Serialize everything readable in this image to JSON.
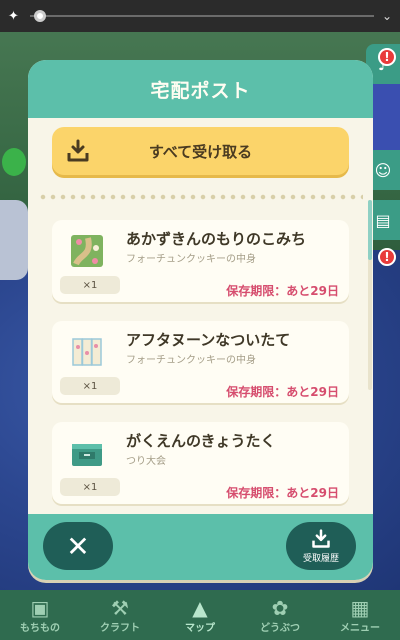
{
  "topbar": {
    "mode_icon": "sparkle-icon",
    "chevron": "⌄"
  },
  "side_badges": [
    "!",
    "!"
  ],
  "modal": {
    "title": "宅配ポスト",
    "receive_all_label": "すべて受け取る",
    "items": [
      {
        "name": "あかずきんのもりのこみち",
        "source": "フォーチュンクッキーの中身",
        "quantity": "×1",
        "expiry": "保存期限：あと29日",
        "icon": "forest-path-icon"
      },
      {
        "name": "アフタヌーンなついたて",
        "source": "フォーチュンクッキーの中身",
        "quantity": "×1",
        "expiry": "保存期限：あと29日",
        "icon": "folding-screen-icon"
      },
      {
        "name": "がくえんのきょうたく",
        "source": "つり大会",
        "quantity": "×1",
        "expiry": "保存期限：あと29日",
        "icon": "teacher-desk-icon"
      }
    ],
    "close_symbol": "✕",
    "history_label": "受取履歴"
  },
  "bottom_nav": [
    {
      "label": "もちもの",
      "icon": "▣"
    },
    {
      "label": "クラフト",
      "icon": "⚒"
    },
    {
      "label": "マップ",
      "icon": "▲"
    },
    {
      "label": "どうぶつ",
      "icon": "✿"
    },
    {
      "label": "メニュー",
      "icon": "▦"
    }
  ],
  "colors": {
    "header_teal": "#5cbfaa",
    "button_yellow": "#fbd46a",
    "expiry_pink": "#d64d6e",
    "footer_button": "#1f5e57"
  }
}
